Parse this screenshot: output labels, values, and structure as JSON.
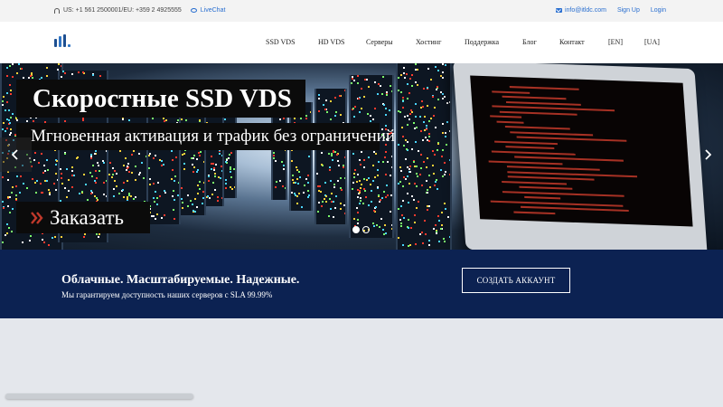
{
  "topbar": {
    "phone_text": "US: +1 561 2500001/EU: +359 2 4925555",
    "livechat": "LiveChat",
    "email": "info@itldc.com",
    "signup": "Sign Up",
    "login": "Login",
    "icons": [
      "phone-icon",
      "chat-icon",
      "mail-icon"
    ]
  },
  "nav": {
    "items": [
      "SSD VDS",
      "HD VDS",
      "Серверы",
      "Хостинг",
      "Поддержка",
      "Блог",
      "Контакт",
      "[EN]",
      "[UA]"
    ]
  },
  "hero": {
    "title": "Скоростные SSD VDS",
    "subtitle": "Мгновенная активация и трафик без ограничений",
    "order_label": "Заказать",
    "slides": 2,
    "active_slide": 1
  },
  "banner": {
    "title": "Облачные. Масштабируемые. Надежные.",
    "subtitle": "Мы гарантируем доступность наших серверов с SLA 99.99%",
    "cta_label": "СОЗДАТЬ АККАУНТ"
  },
  "colors": {
    "link": "#2a6fd0",
    "banner_bg": "#0c2252",
    "accent_red": "#c0392b",
    "page_bg": "#e4e7ec"
  }
}
